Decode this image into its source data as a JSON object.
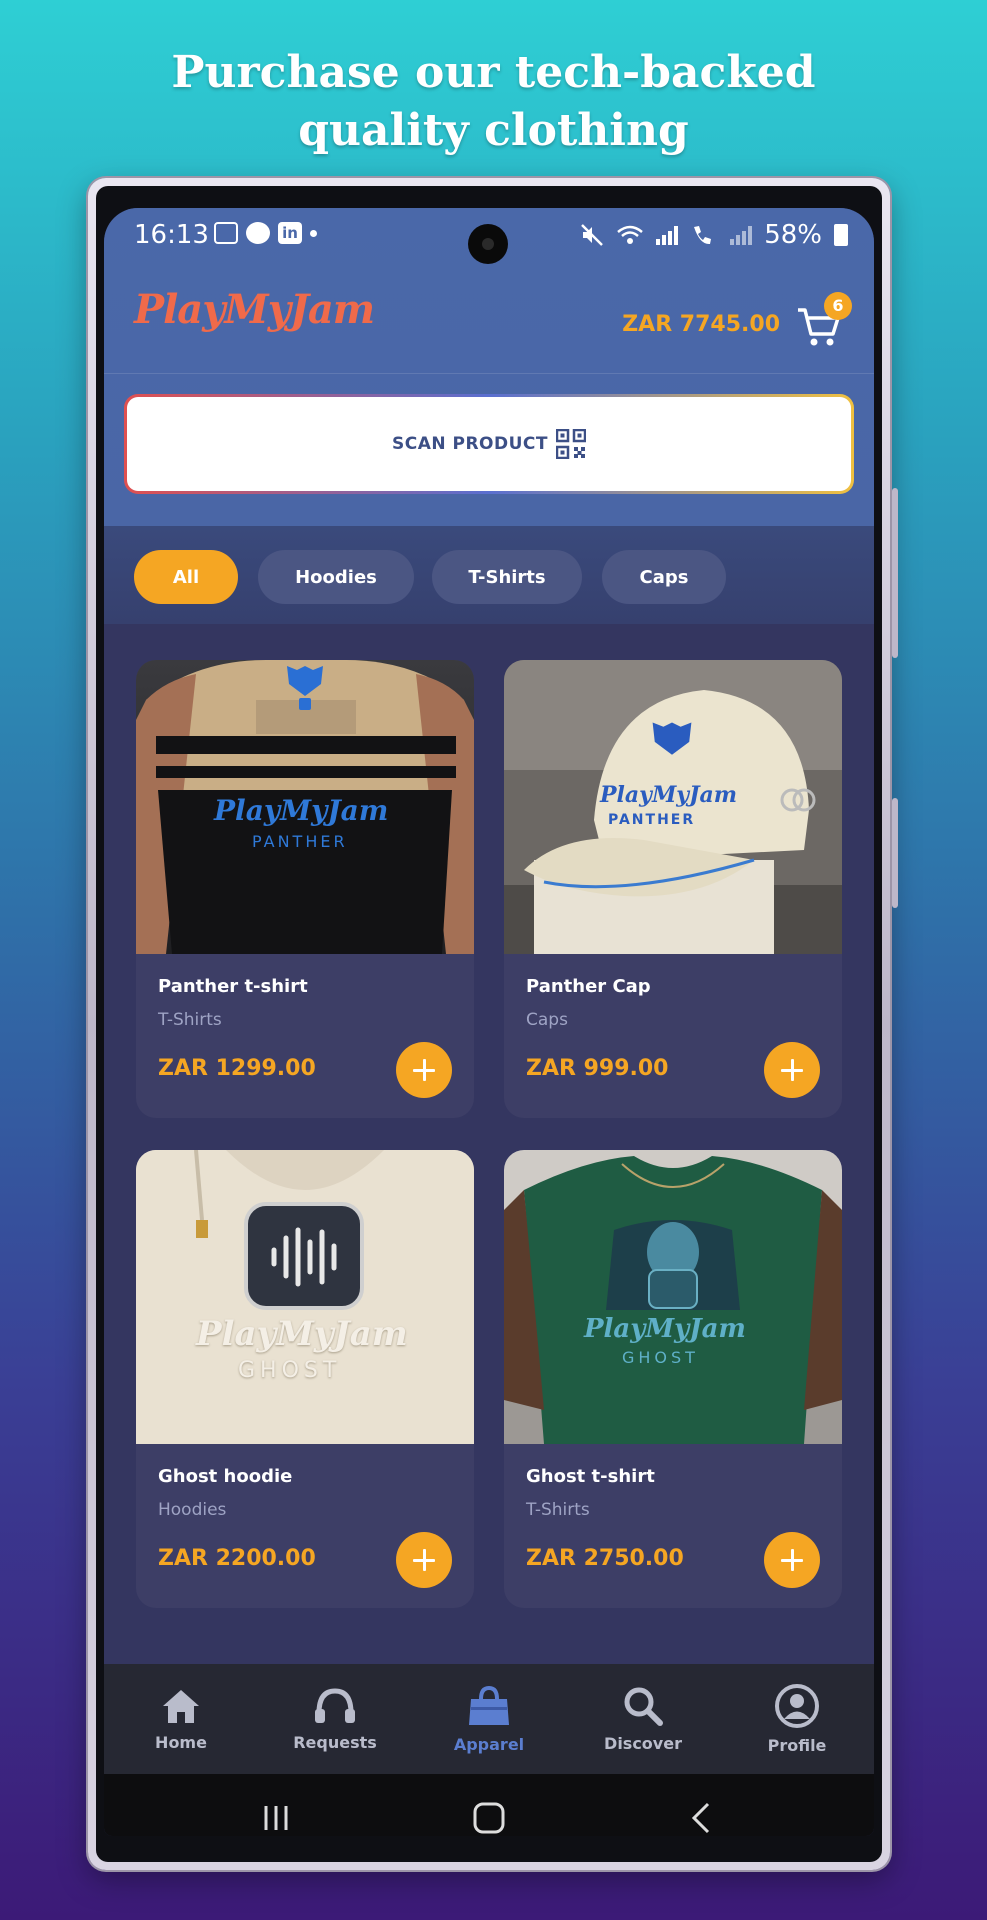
{
  "headline": "Purchase our tech-backed quality clothing",
  "status_bar": {
    "time": "16:13",
    "battery": "58%",
    "icons": [
      "gallery-icon",
      "chat-icon",
      "linkedin-icon",
      "mute-icon",
      "wifi-icon",
      "signal-icon",
      "wifi-call-icon",
      "signal-icon",
      "battery-icon"
    ]
  },
  "header": {
    "logo": "PlayMyJam",
    "cart_total": "ZAR 7745.00",
    "cart_count": "6"
  },
  "scan_button": {
    "label": "SCAN PRODUCT"
  },
  "filters": [
    {
      "label": "All",
      "active": true
    },
    {
      "label": "Hoodies",
      "active": false
    },
    {
      "label": "T-Shirts",
      "active": false
    },
    {
      "label": "Caps",
      "active": false
    }
  ],
  "products": [
    {
      "name": "Panther t-shirt",
      "category": "T-Shirts",
      "price": "ZAR 1299.00",
      "image_text": "PlayMyJam",
      "image_sub": "PANTHER"
    },
    {
      "name": "Panther Cap",
      "category": "Caps",
      "price": "ZAR 999.00",
      "image_text": "PlayMyJam",
      "image_sub": "PANTHER"
    },
    {
      "name": "Ghost hoodie",
      "category": "Hoodies",
      "price": "ZAR 2200.00",
      "image_text": "PlayMyJam",
      "image_sub": "GHOST"
    },
    {
      "name": "Ghost t-shirt",
      "category": "T-Shirts",
      "price": "ZAR 2750.00",
      "image_text": "PlayMyJam",
      "image_sub": "GHOST"
    }
  ],
  "bottom_nav": [
    {
      "label": "Home",
      "icon": "home-icon",
      "active": false
    },
    {
      "label": "Requests",
      "icon": "headphones-icon",
      "active": false
    },
    {
      "label": "Apparel",
      "icon": "shopping-bag-icon",
      "active": true
    },
    {
      "label": "Discover",
      "icon": "search-icon",
      "active": false
    },
    {
      "label": "Profile",
      "icon": "profile-icon",
      "active": false
    }
  ],
  "colors": {
    "accent": "#f5a623",
    "logo": "#f06a4a",
    "header_bg": "#4a68a9",
    "content_bg": "#343660",
    "card_bg": "#3d3e66",
    "nav_active": "#5b7ed0"
  }
}
